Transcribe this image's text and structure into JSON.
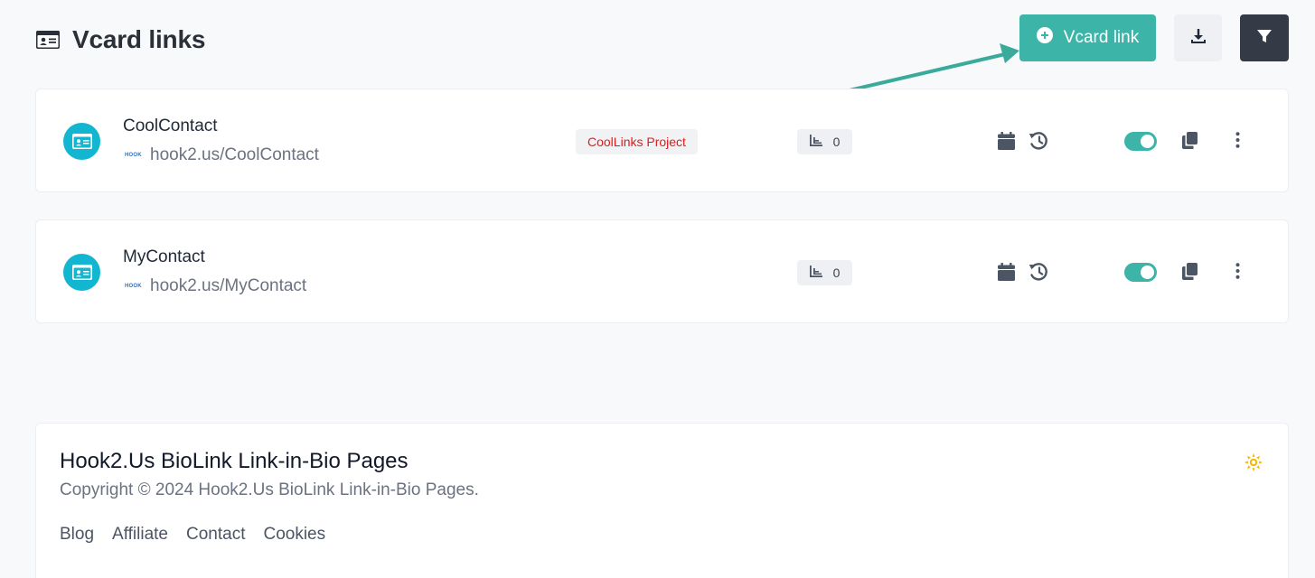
{
  "header": {
    "title": "Vcard links",
    "add_button_label": "Vcard link",
    "title_icon": "id-card-icon",
    "download_icon": "download-icon",
    "filter_icon": "filter-icon"
  },
  "links": [
    {
      "name": "CoolContact",
      "url": "hook2.us/CoolContact",
      "logo_text": "HOOK",
      "project": "CoolLinks Project",
      "stats": "0",
      "enabled": true
    },
    {
      "name": "MyContact",
      "url": "hook2.us/MyContact",
      "logo_text": "HOOK",
      "project": "",
      "stats": "0",
      "enabled": true
    }
  ],
  "footer": {
    "title": "Hook2.Us BioLink Link-in-Bio Pages",
    "copyright": "Copyright © 2024 Hook2.Us BioLink Link-in-Bio Pages.",
    "links": [
      "Blog",
      "Affiliate",
      "Contact",
      "Cookies"
    ]
  },
  "colors": {
    "accent": "#3cb4a7",
    "avatar": "#13b6d0",
    "dark_button": "#343a46",
    "project_text": "#e01b1b",
    "theme_icon": "#f5b800"
  }
}
